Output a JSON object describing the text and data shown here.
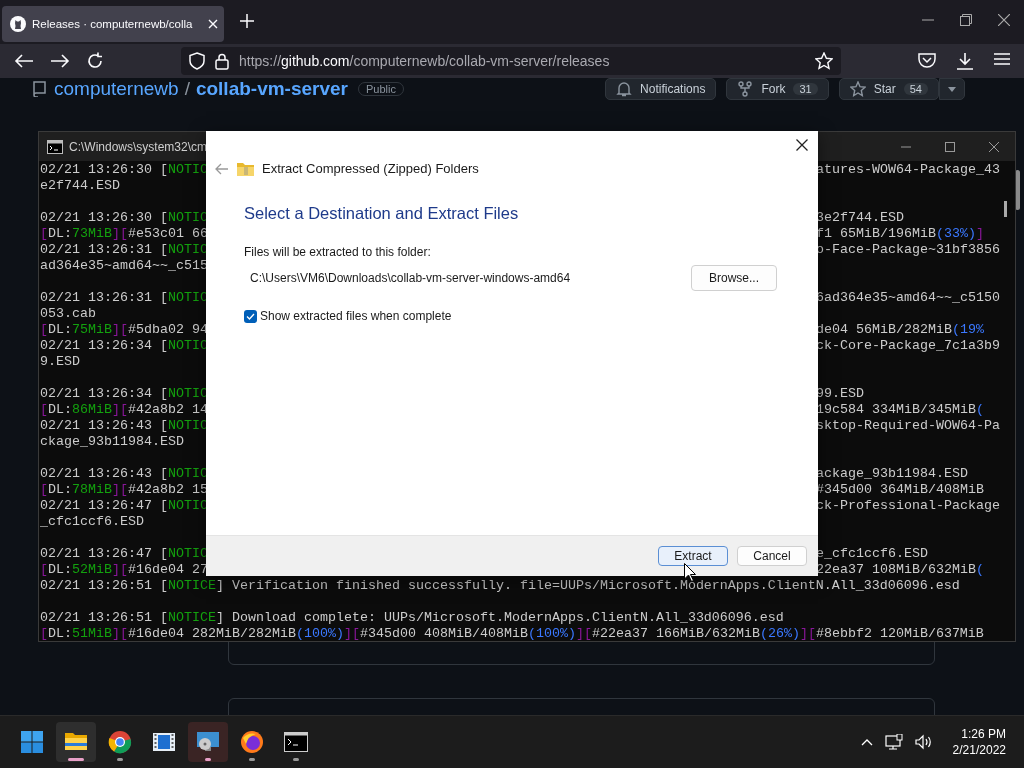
{
  "browser": {
    "tab": {
      "title": "Releases · computernewb/colla",
      "selected": true
    },
    "address": {
      "scheme": "https://",
      "host": "github.com",
      "path": "/computernewb/collab-vm-server/releases"
    }
  },
  "repo": {
    "owner": "computernewb",
    "separator": "/",
    "name": "collab-vm-server",
    "visibility": "Public",
    "buttons": [
      {
        "label": "Notifications"
      },
      {
        "label": "Fork",
        "count": "31"
      },
      {
        "label": "Star",
        "count": "54"
      }
    ]
  },
  "console": {
    "title": "C:\\Windows\\system32\\cm",
    "lines": [
      {
        "kind": "split",
        "left": [
          {
            "text": "02/21 13:26:30 [",
            "kind": "plain"
          },
          {
            "text": "NOTIC",
            "kind": "notice"
          }
        ],
        "right": [
          {
            "text": "atures-WOW64-Package_43",
            "kind": "plain"
          }
        ]
      },
      {
        "kind": "split",
        "left": [
          {
            "text": "e2f744.ESD",
            "kind": "plain"
          }
        ]
      },
      {
        "kind": "blank"
      },
      {
        "kind": "split",
        "left": [
          {
            "text": "02/21 13:26:30 [",
            "kind": "plain"
          },
          {
            "text": "NOTIC",
            "kind": "notice"
          }
        ],
        "right": [
          {
            "text": "3e2f744.ESD",
            "kind": "plain"
          }
        ]
      },
      {
        "kind": "split",
        "left": [
          {
            "text": "[",
            "kind": "mark"
          },
          {
            "text": "DL:",
            "kind": "plain"
          },
          {
            "text": "73MiB",
            "kind": "rate"
          },
          {
            "text": "][",
            "kind": "mark"
          },
          {
            "text": "#e53c01 66",
            "kind": "plain"
          }
        ],
        "right": [
          {
            "text": "f1 65MiB/196MiB",
            "kind": "plain"
          },
          {
            "text": "(33%)",
            "kind": "share"
          },
          {
            "text": "]",
            "kind": "mark"
          }
        ]
      },
      {
        "kind": "split",
        "left": [
          {
            "text": "02/21 13:26:31 [",
            "kind": "plain"
          },
          {
            "text": "NOTIC",
            "kind": "notice"
          }
        ],
        "right": [
          {
            "text": "o-Face-Package~31bf3856",
            "kind": "plain"
          }
        ]
      },
      {
        "kind": "split",
        "left": [
          {
            "text": "ad364e35~amd64~~_c515",
            "kind": "plain"
          }
        ]
      },
      {
        "kind": "blank"
      },
      {
        "kind": "split",
        "left": [
          {
            "text": "02/21 13:26:31 [",
            "kind": "plain"
          },
          {
            "text": "NOTIC",
            "kind": "notice"
          }
        ],
        "right": [
          {
            "text": "6ad364e35~amd64~~_c5150",
            "kind": "plain"
          }
        ]
      },
      {
        "kind": "split",
        "left": [
          {
            "text": "053.cab",
            "kind": "plain"
          }
        ]
      },
      {
        "kind": "split",
        "left": [
          {
            "text": "[",
            "kind": "mark"
          },
          {
            "text": "DL:",
            "kind": "plain"
          },
          {
            "text": "75MiB",
            "kind": "rate"
          },
          {
            "text": "][",
            "kind": "mark"
          },
          {
            "text": "#5dba02 94",
            "kind": "plain"
          }
        ],
        "right": [
          {
            "text": "de04 56MiB/282MiB",
            "kind": "plain"
          },
          {
            "text": "(19%",
            "kind": "share"
          }
        ]
      },
      {
        "kind": "split",
        "left": [
          {
            "text": "02/21 13:26:34 [",
            "kind": "plain"
          },
          {
            "text": "NOTIC",
            "kind": "notice"
          }
        ],
        "right": [
          {
            "text": "ck-Core-Package_7c1a3b9",
            "kind": "plain"
          }
        ]
      },
      {
        "kind": "split",
        "left": [
          {
            "text": "9.ESD",
            "kind": "plain"
          }
        ]
      },
      {
        "kind": "blank"
      },
      {
        "kind": "split",
        "left": [
          {
            "text": "02/21 13:26:34 [",
            "kind": "plain"
          },
          {
            "text": "NOTIC",
            "kind": "notice"
          }
        ],
        "right": [
          {
            "text": "99.ESD",
            "kind": "plain"
          }
        ]
      },
      {
        "kind": "split",
        "left": [
          {
            "text": "[",
            "kind": "mark"
          },
          {
            "text": "DL:",
            "kind": "plain"
          },
          {
            "text": "86MiB",
            "kind": "rate"
          },
          {
            "text": "][",
            "kind": "mark"
          },
          {
            "text": "#42a8b2 14",
            "kind": "plain"
          }
        ],
        "right": [
          {
            "text": "19c584 334MiB/345MiB",
            "kind": "plain"
          },
          {
            "text": "(",
            "kind": "share"
          }
        ]
      },
      {
        "kind": "split",
        "left": [
          {
            "text": "02/21 13:26:43 [",
            "kind": "plain"
          },
          {
            "text": "NOTIC",
            "kind": "notice"
          }
        ],
        "right": [
          {
            "text": "sktop-Required-WOW64-Pa",
            "kind": "plain"
          }
        ]
      },
      {
        "kind": "split",
        "left": [
          {
            "text": "ckage_93b11984.ESD",
            "kind": "plain"
          }
        ]
      },
      {
        "kind": "blank"
      },
      {
        "kind": "split",
        "left": [
          {
            "text": "02/21 13:26:43 [",
            "kind": "plain"
          },
          {
            "text": "NOTIC",
            "kind": "notice"
          }
        ],
        "right": [
          {
            "text": "ackage_93b11984.ESD",
            "kind": "plain"
          }
        ]
      },
      {
        "kind": "split",
        "left": [
          {
            "text": "[",
            "kind": "mark"
          },
          {
            "text": "DL:",
            "kind": "plain"
          },
          {
            "text": "78MiB",
            "kind": "rate"
          },
          {
            "text": "][",
            "kind": "mark"
          },
          {
            "text": "#42a8b2 15",
            "kind": "plain"
          }
        ],
        "right": [
          {
            "text": "#345d00 364MiB/408MiB",
            "kind": "plain"
          }
        ]
      },
      {
        "kind": "split",
        "left": [
          {
            "text": "02/21 13:26:47 [",
            "kind": "plain"
          },
          {
            "text": "NOTIC",
            "kind": "notice"
          }
        ],
        "right": [
          {
            "text": "ck-Professional-Package",
            "kind": "plain"
          }
        ]
      },
      {
        "kind": "split",
        "left": [
          {
            "text": "_cfc1ccf6.ESD",
            "kind": "plain"
          }
        ]
      },
      {
        "kind": "blank"
      },
      {
        "kind": "split",
        "left": [
          {
            "text": "02/21 13:26:47 [",
            "kind": "plain"
          },
          {
            "text": "NOTIC",
            "kind": "notice"
          }
        ],
        "right": [
          {
            "text": "e_cfc1ccf6.ESD",
            "kind": "plain"
          }
        ]
      },
      {
        "kind": "split",
        "left": [
          {
            "text": "[",
            "kind": "mark"
          },
          {
            "text": "DL:",
            "kind": "plain"
          },
          {
            "text": "52MiB",
            "kind": "rate"
          },
          {
            "text": "][",
            "kind": "mark"
          },
          {
            "text": "#16de04 27",
            "kind": "plain"
          }
        ],
        "right": [
          {
            "text": "22ea37 108MiB/632MiB",
            "kind": "plain"
          },
          {
            "text": "(",
            "kind": "share"
          }
        ]
      },
      {
        "kind": "full",
        "segments": [
          {
            "text": "02/21 13:26:51 [",
            "kind": "plain"
          },
          {
            "text": "NOTICE",
            "kind": "notice"
          },
          {
            "text": "] Verification finished successfully. file=UUPs/Microsoft.ModernApps.ClientN.All_33d06096.esd",
            "kind": "plain"
          }
        ]
      },
      {
        "kind": "blank"
      },
      {
        "kind": "full",
        "segments": [
          {
            "text": "02/21 13:26:51 [",
            "kind": "plain"
          },
          {
            "text": "NOTICE",
            "kind": "notice"
          },
          {
            "text": "] Download complete: UUPs/Microsoft.ModernApps.ClientN.All_33d06096.esd",
            "kind": "plain"
          }
        ]
      },
      {
        "kind": "full",
        "segments": [
          {
            "text": "[",
            "kind": "mark"
          },
          {
            "text": "DL:",
            "kind": "plain"
          },
          {
            "text": "51MiB",
            "kind": "rate"
          },
          {
            "text": "][",
            "kind": "mark"
          },
          {
            "text": "#16de04 282MiB/282MiB",
            "kind": "plain"
          },
          {
            "text": "(100%)",
            "kind": "share"
          },
          {
            "text": "][",
            "kind": "mark"
          },
          {
            "text": "#345d00 408MiB/408MiB",
            "kind": "plain"
          },
          {
            "text": "(100%)",
            "kind": "share"
          },
          {
            "text": "][",
            "kind": "mark"
          },
          {
            "text": "#22ea37 166MiB/632MiB",
            "kind": "plain"
          },
          {
            "text": "(26%)",
            "kind": "share"
          },
          {
            "text": "][",
            "kind": "mark"
          },
          {
            "text": "#8ebbf2 120MiB/637MiB",
            "kind": "plain"
          }
        ]
      }
    ]
  },
  "dialog": {
    "title": "Extract Compressed (Zipped) Folders",
    "heading": "Select a Destination and Extract Files",
    "folder_label": "Files will be extracted to this folder:",
    "folder_path": "C:\\Users\\VM6\\Downloads\\collab-vm-server-windows-amd64",
    "browse": "Browse...",
    "show_files": {
      "label": "Show extracted files when complete",
      "checked": true
    },
    "buttons": [
      {
        "label": "Extract",
        "selected": true
      },
      {
        "label": "Cancel",
        "selected": false
      }
    ]
  },
  "taskbar": {
    "apps": [
      {
        "kind": "folder",
        "selected": true,
        "running": true,
        "attention": false
      },
      {
        "kind": "ring",
        "selected": false,
        "running": true,
        "attention": false
      },
      {
        "kind": "film",
        "selected": false,
        "running": false,
        "attention": false
      },
      {
        "kind": "disc",
        "selected": false,
        "running": true,
        "attention": true
      },
      {
        "kind": "flame",
        "selected": false,
        "running": true,
        "attention": false
      },
      {
        "kind": "console",
        "selected": false,
        "running": true,
        "attention": false
      }
    ],
    "time": "1:26 PM",
    "date": "2/21/2022"
  }
}
